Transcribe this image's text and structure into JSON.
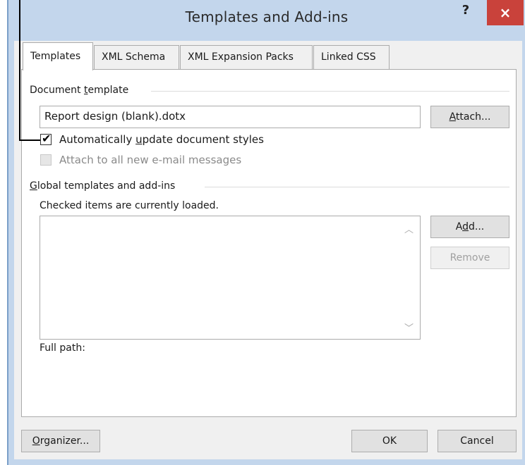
{
  "window": {
    "title": "Templates and Add-ins",
    "help_label": "?",
    "close_label": "×"
  },
  "tabs": [
    {
      "label": "Templates",
      "active": true
    },
    {
      "label": "XML Schema",
      "active": false
    },
    {
      "label": "XML Expansion Packs",
      "active": false
    },
    {
      "label": "Linked CSS",
      "active": false
    }
  ],
  "document_template": {
    "section_label_pre": "Document ",
    "section_label_u": "t",
    "section_label_post": "emplate",
    "value": "Report design (blank).dotx",
    "attach_pre": "",
    "attach_u": "A",
    "attach_post": "ttach...",
    "auto_update": {
      "pre": "Automatically ",
      "u": "u",
      "post": "pdate document styles",
      "checked": true
    },
    "attach_all": {
      "label": "Attach to all new e-mail messages",
      "checked": false,
      "enabled": false
    }
  },
  "global": {
    "section_u": "G",
    "section_post": "lobal templates and add-ins",
    "note": "Checked items are currently loaded.",
    "add_pre": "A",
    "add_u": "d",
    "add_post": "d...",
    "remove_label": "Remove",
    "full_path_label": "Full path:"
  },
  "footer": {
    "organizer_u": "O",
    "organizer_post": "rganizer...",
    "ok_label": "OK",
    "cancel_label": "Cancel"
  },
  "icons": [
    "check-icon",
    "scroll-up-icon",
    "scroll-down-icon",
    "help-icon",
    "close-icon"
  ]
}
